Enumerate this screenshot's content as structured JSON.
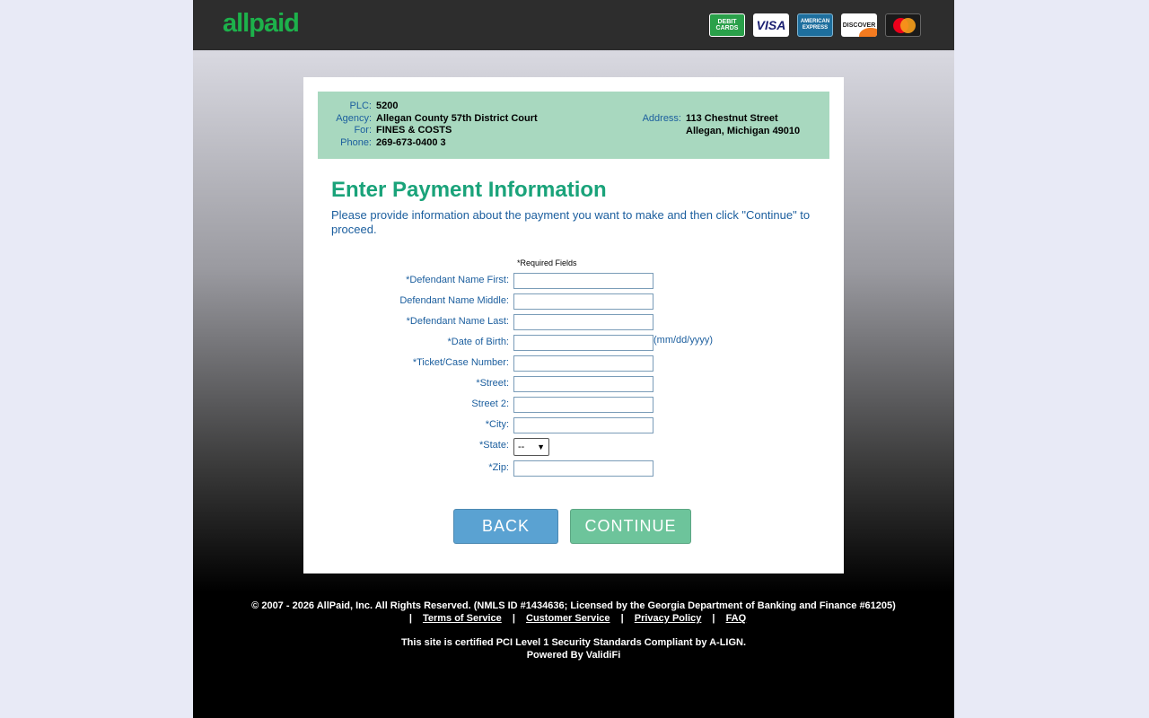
{
  "header": {
    "logo": "allpaid",
    "cards": {
      "debit_line1": "DEBIT",
      "debit_line2": "CARDS",
      "visa": "VISA",
      "amex_line1": "AMERICAN",
      "amex_line2": "EXPRESS",
      "discover": "DISCOVER"
    }
  },
  "info": {
    "plc_label": "PLC:",
    "plc_value": "5200",
    "agency_label": "Agency:",
    "agency_value": "Allegan County 57th District Court",
    "for_label": "For:",
    "for_value": "FINES & COSTS",
    "phone_label": "Phone:",
    "phone_value": "269-673-0400 3",
    "address_label": "Address:",
    "address_line1": "113 Chestnut Street",
    "address_line2": "Allegan, Michigan 49010"
  },
  "form": {
    "title": "Enter Payment Information",
    "description": "Please provide information about the payment you want to make and then click \"Continue\" to proceed.",
    "required_note": "*Required Fields",
    "fields": {
      "first": {
        "label": "*Defendant Name First:",
        "value": ""
      },
      "middle": {
        "label": "Defendant Name Middle:",
        "value": ""
      },
      "last": {
        "label": "*Defendant Name Last:",
        "value": ""
      },
      "dob": {
        "label": "*Date of Birth:",
        "value": "",
        "hint": "(mm/dd/yyyy)"
      },
      "ticket": {
        "label": "*Ticket/Case Number:",
        "value": ""
      },
      "street": {
        "label": "*Street:",
        "value": ""
      },
      "street2": {
        "label": "Street 2:",
        "value": ""
      },
      "city": {
        "label": "*City:",
        "value": ""
      },
      "state": {
        "label": "*State:",
        "selected": "--"
      },
      "zip": {
        "label": "*Zip:",
        "value": ""
      }
    },
    "back_label": "BACK",
    "continue_label": "CONTINUE"
  },
  "footer": {
    "copyright": "© 2007 - 2026 AllPaid, Inc. All Rights Reserved. (NMLS ID #1434636; Licensed by the Georgia Department of Banking and Finance #61205)",
    "links": [
      "Terms of Service",
      "Customer Service",
      "Privacy Policy",
      "FAQ"
    ],
    "separator": "|",
    "pci": "This site is certified PCI Level 1 Security Standards Compliant by A-LIGN.",
    "powered": "Powered By ValidiFi"
  },
  "colors": {
    "accent_green": "#1aa37a",
    "link_blue": "#1b5e9e",
    "info_bg": "#a8d8bf",
    "back_button": "#5aa2d2",
    "continue_button": "#6dc49b",
    "logo_green": "#1db14b"
  }
}
